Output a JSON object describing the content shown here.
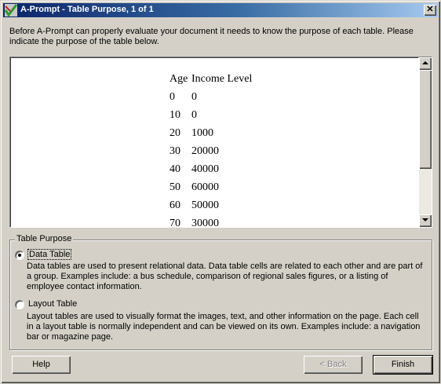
{
  "window": {
    "title": "A-Prompt - Table Purpose, 1 of 1",
    "close_label": "✕"
  },
  "intro_text": "Before A-Prompt can properly evaluate your document it needs to know the purpose of each table. Please indicate the purpose of the table below.",
  "preview_table": {
    "headers": [
      "Age",
      "Income Level"
    ],
    "rows": [
      [
        "0",
        "0"
      ],
      [
        "10",
        "0"
      ],
      [
        "20",
        "1000"
      ],
      [
        "30",
        "20000"
      ],
      [
        "40",
        "40000"
      ],
      [
        "50",
        "60000"
      ],
      [
        "60",
        "50000"
      ],
      [
        "70",
        "30000"
      ]
    ]
  },
  "table_purpose": {
    "group_label": "Table Purpose",
    "options": [
      {
        "label": "Data Table",
        "selected": true,
        "description": "Data tables are used to present relational data. Data table cells are related to each other and are part of a group.  Examples include: a bus schedule, comparison of regional sales figures, or a listing of employee contact information."
      },
      {
        "label": "Layout Table",
        "selected": false,
        "description": "Layout tables are used to visually format the images, text, and other information on the page. Each cell in a layout table is normally independent and can be viewed on its own. Examples include: a navigation bar or magazine page."
      }
    ]
  },
  "buttons": {
    "help": "Help",
    "back": "< Back",
    "finish": "Finish"
  }
}
